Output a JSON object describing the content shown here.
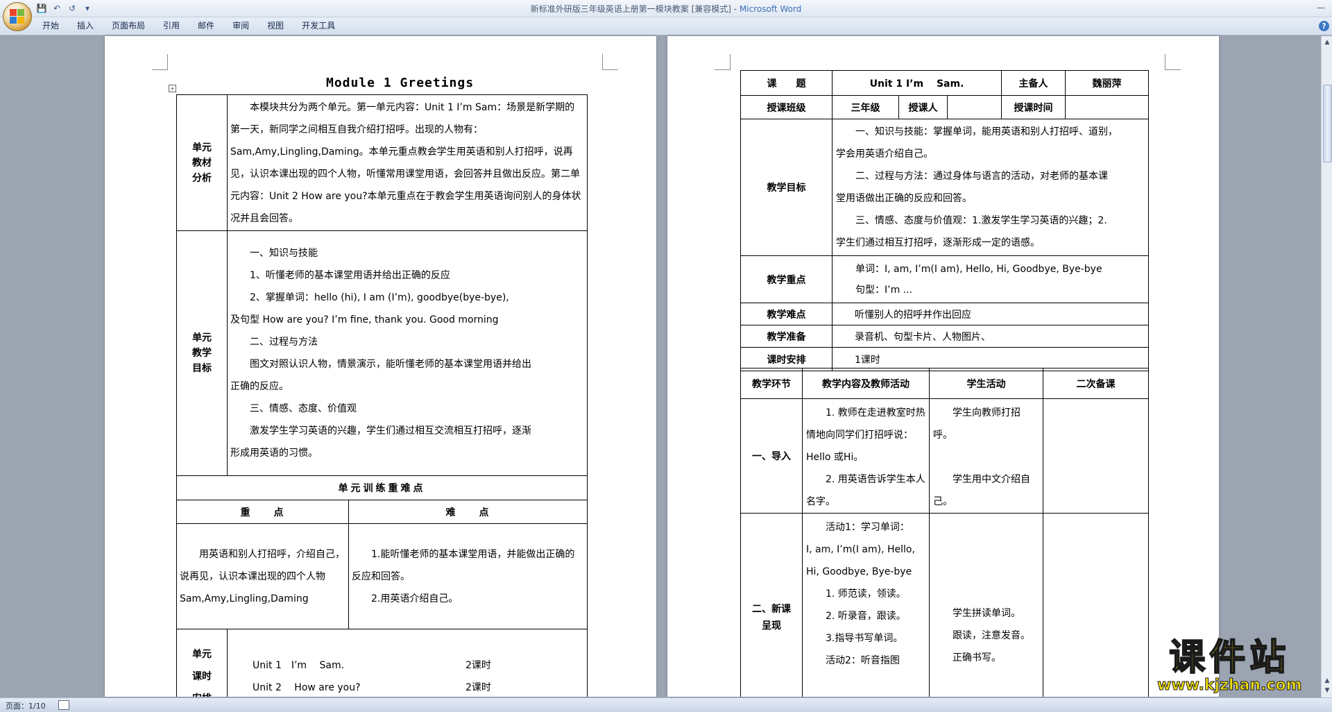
{
  "window": {
    "title": "新标准外研版三年级英语上册第一模块教案 [兼容模式]",
    "app_name": "Microsoft Word",
    "title_separator": " - "
  },
  "quick_access": {
    "save_icon": "save-icon",
    "undo_icon": "undo-icon",
    "redo_icon": "redo-icon",
    "customize_icon": "dropdown-icon"
  },
  "ribbon": {
    "tabs": [
      "开始",
      "插入",
      "页面布局",
      "引用",
      "邮件",
      "审阅",
      "视图",
      "开发工具"
    ]
  },
  "page1": {
    "title": "Module 1 Greetings",
    "analysis_label": [
      "单元",
      "教材",
      "分析"
    ],
    "analysis_text": "本模块共分为两个单元。第一单元内容：Unit 1 I’m Sam：场景是新学期的第一天，新同学之间相互自我介绍打招呼。出现的人物有：Sam,Amy,Lingling,Daming。本单元重点教会学生用英语和别人打招呼，说再见，认识本课出现的四个人物，听懂常用课堂用语，会回答并且做出反应。第二单元内容：Unit 2 How are you?本单元重点在于教会学生用英语询问别人的身体状况并且会回答。",
    "goals_label": [
      "单元",
      "教学",
      "目标"
    ],
    "goals_lines": [
      "一、知识与技能",
      "1、听懂老师的基本课堂用语并给出正确的反应",
      "2、掌握单词：hello (hi), I am (I’m), goodbye(bye-bye),",
      "及句型 How are you? I’m fine, thank you. Good morning",
      "二、过程与方法",
      "图文对照认识人物，情景演示，能听懂老师的基本课堂用语并给出",
      "正确的反应。",
      "三、情感、态度、价值观",
      "激发学生学习英语的兴趣，学生们通过相互交流相互打招呼，逐渐",
      "形成用英语的习惯。"
    ],
    "training_header": "单元训练重难点",
    "key_header": "重　　点",
    "difficulty_header": "难　　点",
    "key_text": "用英语和别人打招呼，介绍自己，说再见，认识本课出现的四个人物 Sam,Amy,Lingling,Daming",
    "difficulty_lines": [
      "1.能听懂老师的基本课堂用语，并能做出正确的反应和回答。",
      "2.用英语介绍自己。"
    ],
    "hours_label": [
      "单元",
      "课时",
      "安排"
    ],
    "hours_rows": [
      {
        "unit": "Unit 1　I’m　 Sam.",
        "hours": "2课时"
      },
      {
        "unit": "Unit 2　 How are you?",
        "hours": "2课时"
      }
    ]
  },
  "page2": {
    "topic_label": "课　　题",
    "topic_value": "Unit 1 I’m　 Sam.",
    "preparer_label": "主备人",
    "preparer_value": "魏丽萍",
    "class_label": "授课班级",
    "class_value": "三年级",
    "teacher_label": "授课人",
    "teacher_value": "",
    "time_label": "授课时间",
    "time_value": "",
    "objectives_label": "教学目标",
    "objectives_lines": [
      "一、知识与技能：掌握单词，能用英语和别人打招呼、道别，",
      "学会用英语介绍自己。",
      "二、过程与方法：通过身体与语言的活动，对老师的基本课",
      "堂用语做出正确的反应和回答。",
      "三、情感、态度与价值观：1.激发学生学习英语的兴趣；2.",
      "学生们通过相互打招呼，逐渐形成一定的语感。"
    ],
    "focus_label": "教学重点",
    "focus_lines": [
      "单词：I, am, I’m(I am), Hello, Hi, Goodbye, Bye-bye",
      "句型：I’m ..."
    ],
    "difficulty_label": "教学难点",
    "difficulty_value": "听懂别人的招呼并作出回应",
    "prep_label": "教学准备",
    "prep_value": "录音机、句型卡片、人物图片、",
    "schedule_label": "课时安排",
    "schedule_value": "1课时",
    "process_headers": [
      "教学环节",
      "教学内容及教师活动",
      "学生活动",
      "二次备课"
    ],
    "intro_label": "一、导入",
    "intro_teacher": [
      "1. 教师在走进教室时热情地向同学们打招呼说：Hello 或Hi。",
      "2. 用英语告诉学生本人名字。"
    ],
    "intro_student": [
      "学生向教师打招呼。",
      "学生用中文介绍自己。"
    ],
    "new_label": [
      "二、新课",
      "呈现"
    ],
    "new_teacher": [
      "活动1：学习单词：",
      "I, am, I’m(I am), Hello, Hi, Goodbye, Bye-bye",
      "1. 师范读，领读。",
      "2. 听录音，跟读。",
      "3.指导书写单词。",
      "活动2：听音指图"
    ],
    "new_student": [
      "学生拼读单词。",
      "跟读，注意发音。",
      "正确书写。"
    ]
  },
  "status": {
    "page_indicator": "页面：1/10"
  },
  "watermark": {
    "main": "课件站",
    "url": "www.kjzhan.com"
  },
  "colors": {
    "app_name": "#3c6fb8",
    "background": "#9ba4b0",
    "watermark": "#f3e00d"
  }
}
